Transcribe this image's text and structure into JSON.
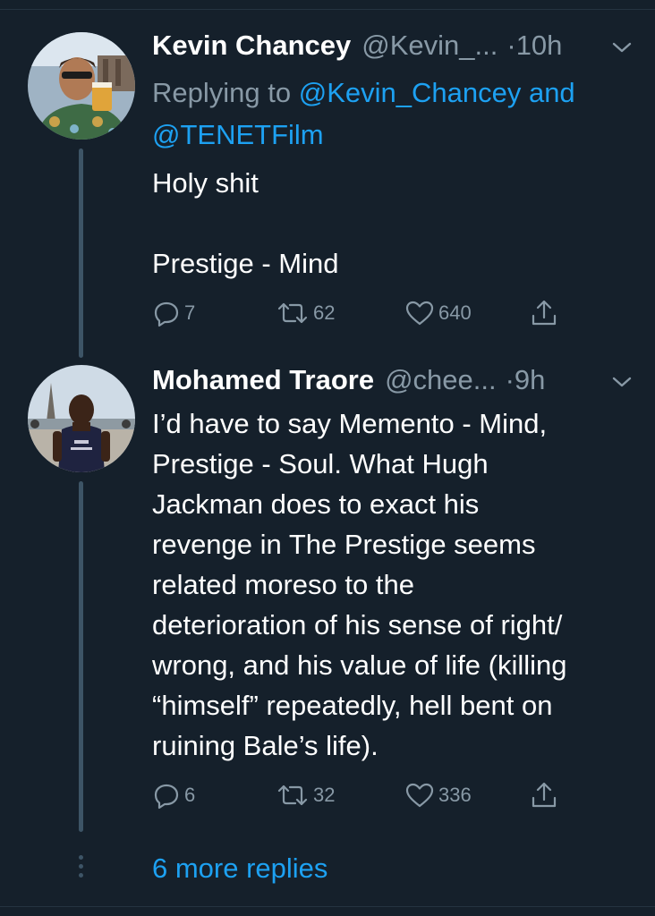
{
  "tweets": [
    {
      "name": "Kevin Chancey",
      "handle": "@Kevin_...",
      "separator": "·",
      "time": "10h",
      "replying_prefix": "Replying to",
      "replying_to_1": "@Kevin_Chancey",
      "replying_and": "and",
      "replying_to_2": "@TENETFilm",
      "text_line1": "Holy shit",
      "text_line2": "Prestige - Mind",
      "replies": "7",
      "retweets": "62",
      "likes": "640"
    },
    {
      "name": "Mohamed Traore",
      "handle": "@chee...",
      "separator": "·",
      "time": "9h",
      "text_lines": [
        "I’d have to say Memento - Mind,",
        "Prestige - Soul. What Hugh",
        "Jackman does to exact his",
        "revenge in The Prestige seems",
        "related moreso to the",
        "deterioration of his sense of right/",
        "wrong, and his value of life (killing",
        "“himself” repeatedly, hell bent on",
        "ruining Bale’s life)."
      ],
      "replies": "6",
      "retweets": "32",
      "likes": "336"
    }
  ],
  "more_replies": "6 more replies",
  "colors": {
    "background": "#15202b",
    "link": "#1da1f2",
    "secondary_text": "#8899a6",
    "thread_line": "#3d5466"
  },
  "icons": [
    "reply-icon",
    "retweet-icon",
    "like-icon",
    "share-icon",
    "chevron-down-icon"
  ]
}
